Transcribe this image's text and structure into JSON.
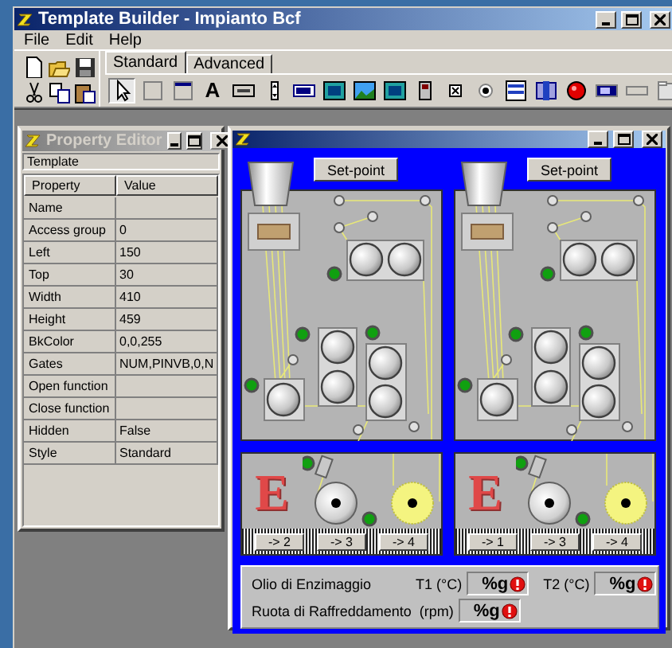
{
  "window": {
    "title": "Template Builder - Impianto Bcf"
  },
  "menu": [
    {
      "label": "File"
    },
    {
      "label": "Edit"
    },
    {
      "label": "Help"
    }
  ],
  "toolbar": {
    "buttons": [
      {
        "kind": "new"
      },
      {
        "kind": "open"
      },
      {
        "kind": "save"
      },
      {
        "kind": "cut"
      },
      {
        "kind": "copy"
      },
      {
        "kind": "paste"
      }
    ],
    "tabs": [
      {
        "label": "Standard",
        "selected": true
      },
      {
        "label": "Advanced",
        "selected": false
      }
    ],
    "tools": [
      {
        "kind": "pointer",
        "selected": true
      },
      {
        "kind": "frame",
        "selected": false
      },
      {
        "kind": "window",
        "selected": false
      },
      {
        "kind": "text",
        "glyph": "A",
        "selected": false
      },
      {
        "kind": "button",
        "selected": false
      },
      {
        "kind": "spin",
        "selected": false
      },
      {
        "kind": "edit",
        "selected": false
      },
      {
        "kind": "image",
        "selected": false
      },
      {
        "kind": "landscape",
        "selected": false
      },
      {
        "kind": "image",
        "selected": false
      },
      {
        "kind": "device",
        "selected": false
      },
      {
        "kind": "checkbox",
        "selected": false
      },
      {
        "kind": "radio",
        "selected": false
      },
      {
        "kind": "list",
        "selected": false
      },
      {
        "kind": "slider",
        "selected": false
      },
      {
        "kind": "led",
        "selected": false
      },
      {
        "kind": "display",
        "selected": false
      },
      {
        "kind": "bar",
        "selected": false
      },
      {
        "kind": "tabs",
        "selected": false
      }
    ]
  },
  "property_editor": {
    "title": "Property Editor",
    "object": "Template",
    "columns": [
      "Property",
      "Value"
    ],
    "rows": [
      {
        "property": "Name"
      },
      {
        "property": "Access group",
        "value": "0"
      },
      {
        "property": "Left",
        "value": "150"
      },
      {
        "property": "Top",
        "value": "30"
      },
      {
        "property": "Width",
        "value": "410"
      },
      {
        "property": "Height",
        "value": "459"
      },
      {
        "property": "BkColor",
        "value": "0,0,255"
      },
      {
        "property": "Gates",
        "value": "NUM,PINVB,0,N"
      },
      {
        "property": "Open function"
      },
      {
        "property": "Close function"
      },
      {
        "property": "Hidden",
        "value": "False"
      },
      {
        "property": "Style",
        "value": "Standard"
      }
    ]
  },
  "template_window": {
    "units": [
      {
        "setpoint": "Set-point",
        "letter": "E",
        "buttons": [
          "-> 2",
          "-> 3",
          "-> 4"
        ]
      },
      {
        "setpoint": "Set-point",
        "letter": "E",
        "buttons": [
          "-> 1",
          "-> 3",
          "-> 4"
        ]
      }
    ],
    "info": {
      "rows": [
        [
          {
            "kind": "name",
            "text": "Olio di Enzimaggio"
          },
          {
            "kind": "label",
            "text": "T1 (°C)"
          },
          {
            "kind": "value",
            "text": "%g"
          },
          {
            "kind": "label",
            "text": "T2 (°C)"
          },
          {
            "kind": "value",
            "text": "%g"
          }
        ],
        [
          {
            "kind": "name",
            "text": "Ruota di Raffreddamento"
          },
          {
            "kind": "label",
            "text": "(rpm)"
          },
          {
            "kind": "value",
            "text": "%g"
          }
        ]
      ]
    }
  }
}
